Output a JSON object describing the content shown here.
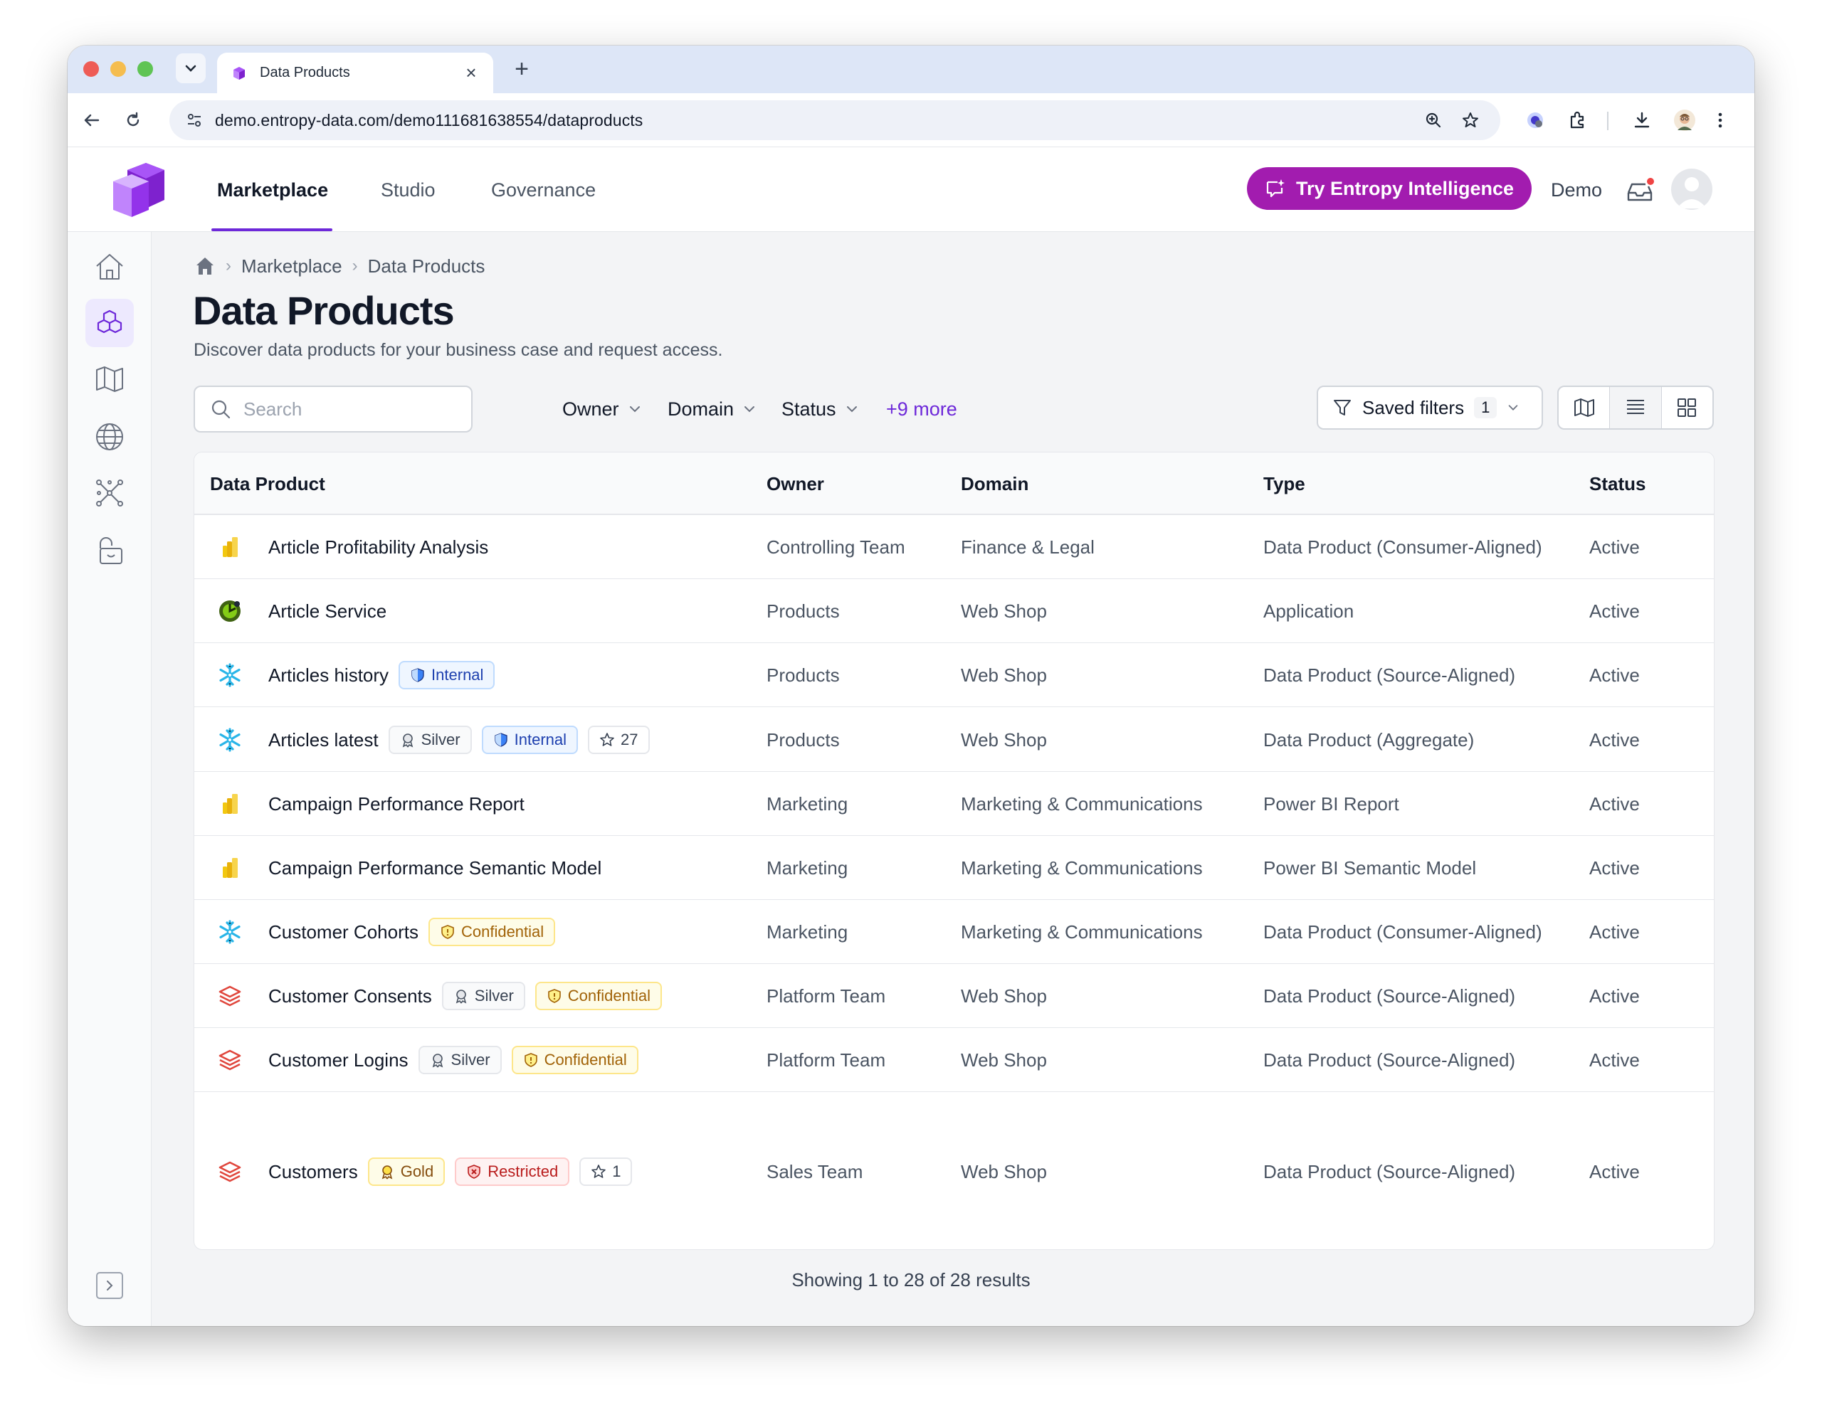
{
  "browser": {
    "tab_title": "Data Products",
    "url": "demo.entropy-data.com/demo111681638554/dataproducts"
  },
  "header": {
    "nav": [
      "Marketplace",
      "Studio",
      "Governance"
    ],
    "ai_button": "Try Entropy Intelligence",
    "org": "Demo"
  },
  "breadcrumb": [
    "Marketplace",
    "Data Products"
  ],
  "page": {
    "title": "Data Products",
    "subtitle": "Discover data products for your business case and request access."
  },
  "filters": {
    "search_placeholder": "Search",
    "owner": "Owner",
    "domain": "Domain",
    "status": "Status",
    "more": "+9 more",
    "saved_filters": "Saved filters",
    "saved_count": "1"
  },
  "table": {
    "columns": [
      "Data Product",
      "Owner",
      "Domain",
      "Type",
      "Status"
    ],
    "rows": [
      {
        "icon": "powerbi-icon",
        "name": "Article Profitability Analysis",
        "badges": [],
        "owner": "Controlling Team",
        "domain": "Finance & Legal",
        "type": "Data Product (Consumer-Aligned)",
        "status": "Active"
      },
      {
        "icon": "application-icon",
        "name": "Article Service",
        "badges": [],
        "owner": "Products",
        "domain": "Web Shop",
        "type": "Application",
        "status": "Active"
      },
      {
        "icon": "snowflake-icon",
        "name": "Articles history",
        "badges": [
          {
            "kind": "internal",
            "label": "Internal"
          }
        ],
        "owner": "Products",
        "domain": "Web Shop",
        "type": "Data Product (Source-Aligned)",
        "status": "Active"
      },
      {
        "icon": "snowflake-icon",
        "name": "Articles latest",
        "badges": [
          {
            "kind": "silver",
            "label": "Silver"
          },
          {
            "kind": "internal",
            "label": "Internal"
          },
          {
            "kind": "star",
            "label": "27"
          }
        ],
        "owner": "Products",
        "domain": "Web Shop",
        "type": "Data Product (Aggregate)",
        "status": "Active"
      },
      {
        "icon": "powerbi-icon",
        "name": "Campaign Performance Report",
        "badges": [],
        "owner": "Marketing",
        "domain": "Marketing & Communications",
        "type": "Power BI Report",
        "status": "Active"
      },
      {
        "icon": "powerbi-icon",
        "name": "Campaign Performance Semantic Model",
        "badges": [],
        "owner": "Marketing",
        "domain": "Marketing & Communications",
        "type": "Power BI Semantic Model",
        "status": "Active"
      },
      {
        "icon": "snowflake-icon",
        "name": "Customer Cohorts",
        "badges": [
          {
            "kind": "confidential",
            "label": "Confidential"
          }
        ],
        "owner": "Marketing",
        "domain": "Marketing & Communications",
        "type": "Data Product (Consumer-Aligned)",
        "status": "Active"
      },
      {
        "icon": "databricks-icon",
        "name": "Customer Consents",
        "badges": [
          {
            "kind": "silver",
            "label": "Silver"
          },
          {
            "kind": "confidential",
            "label": "Confidential"
          }
        ],
        "owner": "Platform Team",
        "domain": "Web Shop",
        "type": "Data Product (Source-Aligned)",
        "status": "Active"
      },
      {
        "icon": "databricks-icon",
        "name": "Customer Logins",
        "badges": [
          {
            "kind": "silver",
            "label": "Silver"
          },
          {
            "kind": "confidential",
            "label": "Confidential"
          }
        ],
        "owner": "Platform Team",
        "domain": "Web Shop",
        "type": "Data Product (Source-Aligned)",
        "status": "Active"
      },
      {
        "icon": "databricks-icon",
        "name": "Customers",
        "badges": [
          {
            "kind": "gold",
            "label": "Gold"
          },
          {
            "kind": "restricted",
            "label": "Restricted"
          },
          {
            "kind": "star",
            "label": "1"
          }
        ],
        "owner": "Sales Team",
        "domain": "Web Shop",
        "type": "Data Product (Source-Aligned)",
        "status": "Active"
      }
    ]
  },
  "footer": "Showing 1 to 28 of 28 results",
  "colors": {
    "accent": "#6d28d9",
    "ai_button": "#a21caf"
  }
}
